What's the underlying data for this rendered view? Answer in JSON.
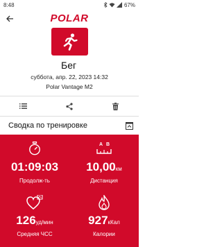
{
  "status_bar": {
    "time": "8:48",
    "battery": "67%"
  },
  "app_bar": {
    "logo": "POLAR"
  },
  "session": {
    "sport": "Бег",
    "date": "суббота, апр. 22, 2023 14:32",
    "device": "Polar Vantage M2"
  },
  "summary": {
    "title": "Сводка по тренировке",
    "metrics": [
      {
        "icon": "stopwatch-icon",
        "value": "01:09:03",
        "unit": "",
        "label": "Продолж-ть"
      },
      {
        "icon": "distance-icon",
        "value": "10,00",
        "unit": "км",
        "label": "Дистанция"
      },
      {
        "icon": "heart-rate-icon",
        "value": "126",
        "unit": "уд/мин",
        "label": "Средняя ЧСС"
      },
      {
        "icon": "calories-flame-icon",
        "value": "927",
        "unit": "кКал",
        "label": "Калории"
      }
    ]
  },
  "colors": {
    "accent": "#d10a2a",
    "background": "#ffffff"
  }
}
